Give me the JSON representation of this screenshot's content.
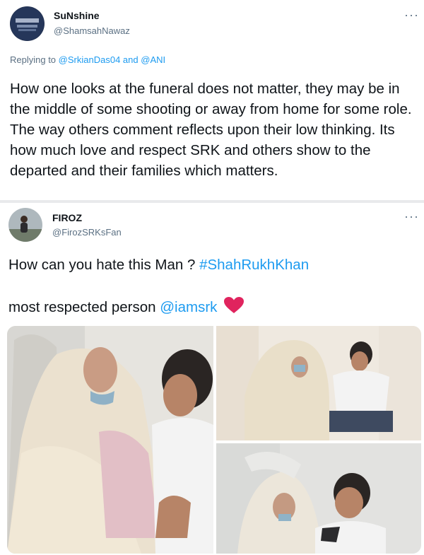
{
  "tweets": [
    {
      "display_name": "SuNshine",
      "handle": "@ShamsahNawaz",
      "replying_prefix": "Replying to",
      "replying_user1": "@SrkianDas04",
      "replying_and": "and",
      "replying_user2": "@ANI",
      "body": "How one looks at the funeral does not matter, they may be in the middle of some shooting or away from home for some role. The way others comment reflects upon their low thinking. Its how much love and respect SRK and others show to the departed and their families which matters.",
      "more": "···"
    },
    {
      "display_name": "FIROZ",
      "handle": "@FirozSRKsFan",
      "line1_text": "How can you hate this Man ? ",
      "line1_hashtag": "#ShahRukhKhan",
      "line2_text": "most respected person ",
      "line2_mention": "@iamsrk",
      "more": "···",
      "photo_count": 3
    }
  ],
  "colors": {
    "text": "#0f1419",
    "secondary": "#5b7083",
    "link": "#1d9bf0",
    "heart": "#e0245e",
    "separator": "#e9eaec"
  },
  "icons": [
    "more-icon",
    "heart-emoji-icon"
  ]
}
